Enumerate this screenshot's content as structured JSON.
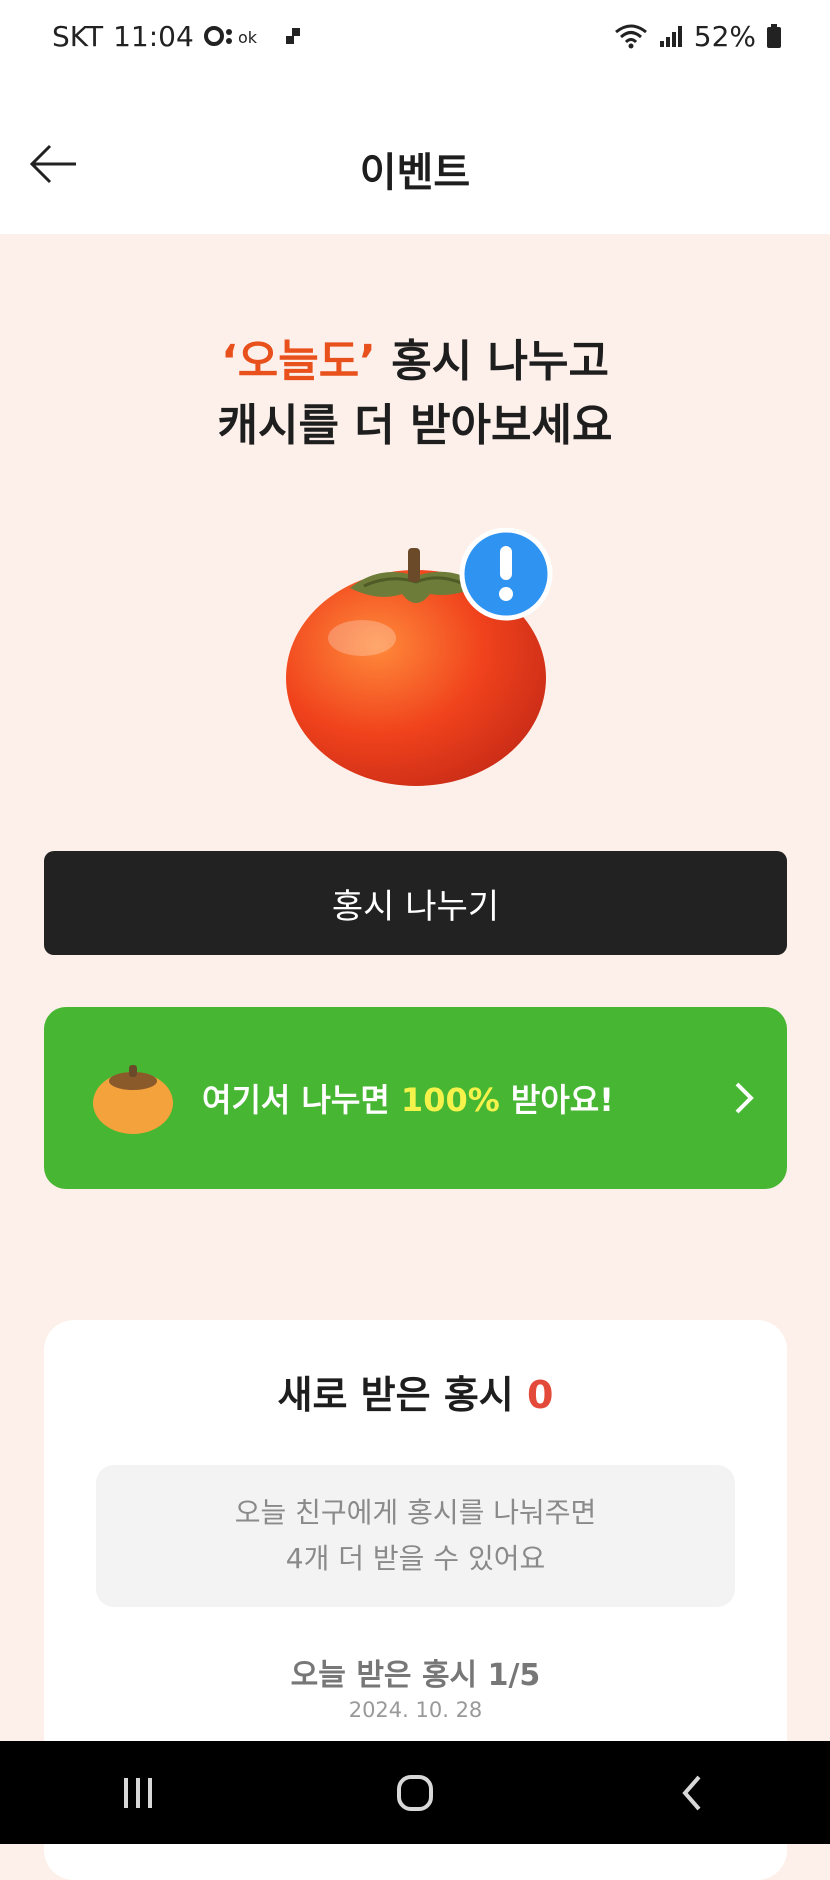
{
  "status_bar": {
    "carrier": "SKT",
    "time": "11:04",
    "battery": "52%"
  },
  "header": {
    "title": "이벤트"
  },
  "hero": {
    "title_accent": "‘오늘도’",
    "title_line1_rest": " 홍시 나누고",
    "title_line2": "캐시를 더 받아보세요"
  },
  "share_button": {
    "label": "홍시 나누기"
  },
  "promo": {
    "text_before": "여기서 나누면 ",
    "text_highlight": "100%",
    "text_after": " 받아요!"
  },
  "received": {
    "title": "새로 받은 홍시",
    "count": "0",
    "notice_line1": "오늘 친구에게 홍시를 나눠주면",
    "notice_line2": "4개 더 받을 수 있어요",
    "today_label": "오늘 받은 홍시 1/5",
    "date": "2024. 10. 28"
  },
  "colors": {
    "background": "#fdf0ea",
    "accent_orange": "#e8501c",
    "promo_green": "#47b632",
    "highlight_yellow": "#f5f24b",
    "count_red": "#e34a3a"
  }
}
